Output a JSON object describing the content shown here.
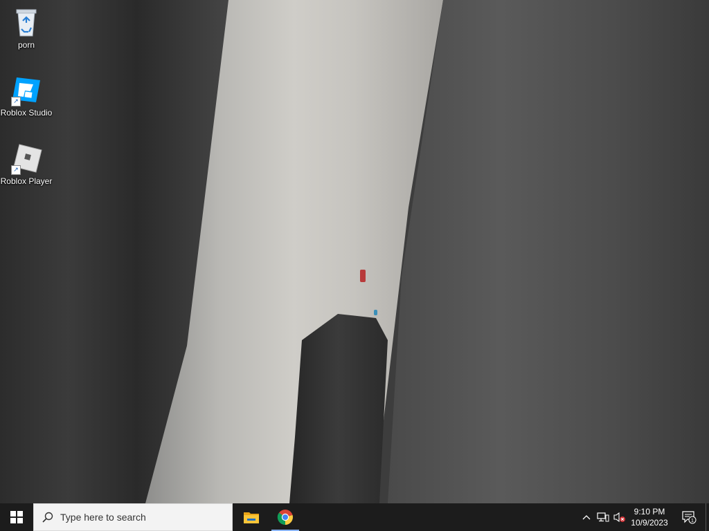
{
  "desktop": {
    "icons": [
      {
        "label": "porn",
        "icon": "recycle-bin-icon"
      },
      {
        "label": "Roblox Studio",
        "icon": "roblox-studio-icon"
      },
      {
        "label": "Roblox Player",
        "icon": "roblox-player-icon"
      }
    ]
  },
  "taskbar": {
    "start_icon": "windows-logo-icon",
    "search_placeholder": "Type here to search",
    "apps": [
      {
        "name": "File Explorer",
        "icon": "folder-icon"
      },
      {
        "name": "Google Chrome",
        "icon": "chrome-icon"
      }
    ],
    "tray": {
      "time": "9:10 PM",
      "date": "10/9/2023",
      "notification_count": "1"
    }
  },
  "colors": {
    "taskbar_bg": "#1c1c1c",
    "search_bg": "#f3f3f3",
    "active_indicator": "#8ab4f8"
  }
}
